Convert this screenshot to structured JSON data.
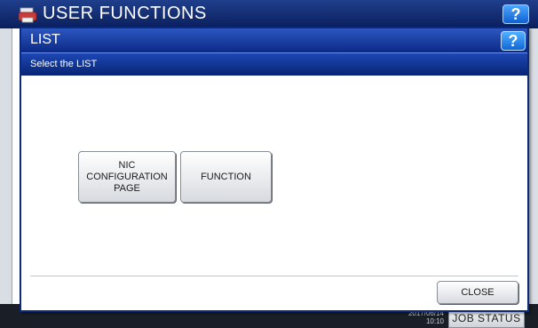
{
  "background_screen": {
    "title": "USER FUNCTIONS",
    "help_label": "?",
    "date_line": "2017/06/14",
    "time_line": "10:10",
    "job_status_label": "JOB STATUS"
  },
  "dialog": {
    "title": "LIST",
    "help_label": "?",
    "subtitle": "Select the LIST",
    "options": [
      {
        "label": "NIC\nCONFIGURATION\nPAGE"
      },
      {
        "label": "FUNCTION"
      }
    ],
    "close_label": "CLOSE"
  },
  "colors": {
    "title_bar": "#0b2a86",
    "help_button": "#1166d6",
    "button_face": "#e6e8eb"
  },
  "icons": {
    "background_app": "printer-icon"
  }
}
